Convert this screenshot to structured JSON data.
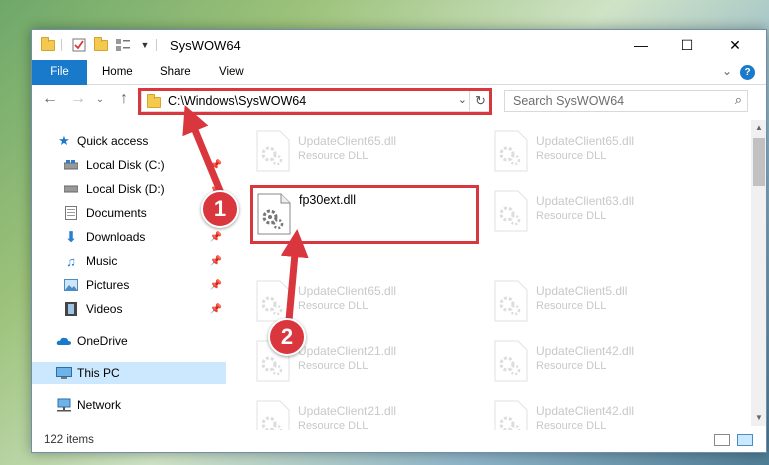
{
  "window": {
    "title": "SysWOW64",
    "controls": {
      "minimize": "—",
      "maximize": "☐",
      "close": "✕"
    }
  },
  "ribbon": {
    "tabs": [
      "File",
      "Home",
      "Share",
      "View"
    ],
    "expand_glyph": "⌄",
    "help_glyph": "?"
  },
  "navigation": {
    "back": "←",
    "forward": "→",
    "recent": "⌄",
    "up": "↑",
    "address": "C:\\Windows\\SysWOW64",
    "address_dropdown": "⌄",
    "refresh": "↻",
    "search_placeholder": "Search SysWOW64",
    "search_glyph": "⌕"
  },
  "sidebar": {
    "items": [
      {
        "label": "Quick access",
        "icon": "star-icon",
        "pinned": false
      },
      {
        "label": "Local Disk (C:)",
        "icon": "drive-icon",
        "pinned": true
      },
      {
        "label": "Local Disk (D:)",
        "icon": "drive-icon",
        "pinned": true
      },
      {
        "label": "Documents",
        "icon": "document-icon",
        "pinned": true
      },
      {
        "label": "Downloads",
        "icon": "download-icon",
        "pinned": true
      },
      {
        "label": "Music",
        "icon": "music-icon",
        "pinned": true
      },
      {
        "label": "Pictures",
        "icon": "pictures-icon",
        "pinned": true
      },
      {
        "label": "Videos",
        "icon": "video-icon",
        "pinned": true
      },
      {
        "label": "OneDrive",
        "icon": "cloud-icon",
        "pinned": false
      },
      {
        "label": "This PC",
        "icon": "computer-icon",
        "pinned": false,
        "selected": true
      },
      {
        "label": "Network",
        "icon": "network-icon",
        "pinned": false
      }
    ]
  },
  "files": {
    "left_column": [
      {
        "name": "UpdateClient65.dll",
        "type": "Resource DLL"
      },
      {
        "name": "fp30ext.dll",
        "type": ""
      },
      {
        "name": "UpdateClient65.dll",
        "type": "Resource DLL"
      },
      {
        "name": "UpdateClient21.dll",
        "type": "Resource DLL"
      },
      {
        "name": "UpdateClient21.dll",
        "type": "Resource DLL"
      }
    ],
    "right_column": [
      {
        "name": "UpdateClient65.dll",
        "type": "Resource DLL"
      },
      {
        "name": "UpdateClient63.dll",
        "type": "Resource DLL"
      },
      {
        "name": "UpdateClient5.dll",
        "type": "Resource DLL"
      },
      {
        "name": "UpdateClient42.dll",
        "type": "Resource DLL"
      },
      {
        "name": "UpdateClient42.dll",
        "type": "Resource DLL"
      }
    ]
  },
  "status": {
    "item_count": "122 items"
  },
  "annotations": {
    "step1": "1",
    "step2": "2"
  },
  "colors": {
    "accent": "#1979ca",
    "highlight": "#d9363e",
    "selection": "#cce8ff"
  }
}
